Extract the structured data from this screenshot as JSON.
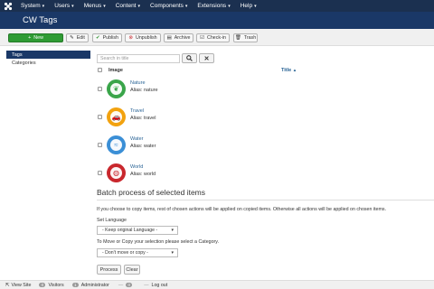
{
  "topnav": {
    "items": [
      {
        "label": "System"
      },
      {
        "label": "Users"
      },
      {
        "label": "Menus"
      },
      {
        "label": "Content"
      },
      {
        "label": "Components"
      },
      {
        "label": "Extensions"
      },
      {
        "label": "Help"
      }
    ]
  },
  "header": {
    "title": "CW Tags"
  },
  "toolbar": {
    "new": "New",
    "edit": "Edit",
    "publish": "Publish",
    "unpublish": "Unpublish",
    "archive": "Archive",
    "checkin": "Check-in",
    "trash": "Trash"
  },
  "sidebar": {
    "items": [
      {
        "label": "Tags",
        "active": true
      },
      {
        "label": "Categories",
        "active": false
      }
    ]
  },
  "search": {
    "placeholder": "Search in title"
  },
  "table": {
    "col_image": "Image",
    "col_title": "Title",
    "sort_indicator": "▲",
    "rows": [
      {
        "name": "Nature",
        "alias": "Alias: nature",
        "color": "#3aa54a",
        "icon": "leaf-icon"
      },
      {
        "name": "Travel",
        "alias": "Alias: travel",
        "color": "#f2a20f",
        "icon": "car-icon"
      },
      {
        "name": "Water",
        "alias": "Alias: water",
        "color": "#3b8fd6",
        "icon": "water-icon"
      },
      {
        "name": "World",
        "alias": "Alias: world",
        "color": "#c9272d",
        "icon": "globe-icon"
      }
    ]
  },
  "batch": {
    "title": "Batch process of selected items",
    "info": "If you choose to copy items, rest of chosen actions will be applied on copied items. Otherwise all actions will be applied on chosen items.",
    "language_label": "Set Language",
    "language_value": "- Keep original Language -",
    "category_label": "To Move or Copy your selection please select a Category.",
    "category_value": "- Don't move or copy -",
    "process": "Process",
    "clear": "Clear"
  },
  "status": {
    "view_site": "View Site",
    "visitors_count": "0",
    "visitors": "Visitors",
    "admin_count": "1",
    "administrator": "Administrator",
    "messages_count": "0",
    "logout": "Log out"
  },
  "colors": {
    "navbar": "#1b3050",
    "header": "#1a3867",
    "new_button": "#2f9b34",
    "link": "#2a6496"
  }
}
